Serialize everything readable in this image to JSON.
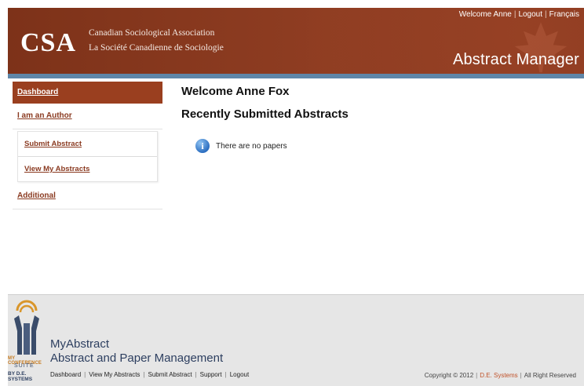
{
  "header": {
    "logo_text": "CSA",
    "org_name_en": "Canadian Sociological Association",
    "org_name_fr": "La Société Canadienne de Sociologie",
    "app_title": "Abstract Manager",
    "welcome_link": "Welcome Anne",
    "logout_link": "Logout",
    "language_link": "Français"
  },
  "sidebar": {
    "dashboard": "Dashboard",
    "author_section": "I am an Author",
    "submit_abstract": "Submit Abstract",
    "view_my_abstracts": "View My Abstracts",
    "additional": "Additional"
  },
  "main": {
    "welcome_heading": "Welcome Anne Fox",
    "recent_heading": "Recently Submitted Abstracts",
    "empty_message": "There are no papers",
    "info_icon": "i"
  },
  "footer": {
    "logo_line1": "MY CONFERENCE",
    "logo_line2": "SUITE",
    "logo_line3": "BY D.E. SYSTEMS",
    "brand_title": "MyAbstract",
    "brand_subtitle": "Abstract and Paper Management",
    "links": {
      "dashboard": "Dashboard",
      "view_my_abstracts": "View My Abstracts",
      "submit_abstract": "Submit Abstract",
      "support": "Support",
      "logout": "Logout"
    },
    "copyright_prefix": "Copyright © 2012",
    "company": "D.E. Systems",
    "rights": "All Right Reserved"
  },
  "colors": {
    "header_brown": "#8a3a20",
    "accent_blue": "#5f86a8",
    "nav_active": "#9a3f1f",
    "footer_bg": "#e6e6e6"
  }
}
